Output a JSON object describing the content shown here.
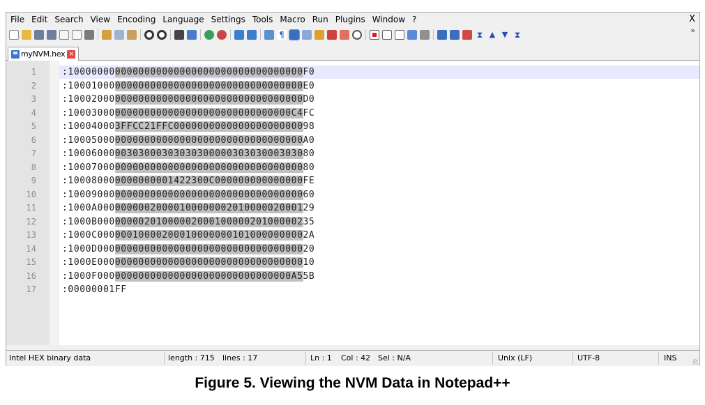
{
  "menu": [
    "File",
    "Edit",
    "Search",
    "View",
    "Encoding",
    "Language",
    "Settings",
    "Tools",
    "Macro",
    "Run",
    "Plugins",
    "Window",
    "?"
  ],
  "window_close": "X",
  "toolbar_overflow": "»",
  "tab": {
    "filename": "myNVM.hex",
    "close": "×"
  },
  "lines": [
    {
      "n": "1",
      "pre": ":10000000",
      "sel": "00000000000000000000000000000000",
      "post": "F0"
    },
    {
      "n": "2",
      "pre": ":10001000",
      "sel": "00000000000000000000000000000000",
      "post": "E0"
    },
    {
      "n": "3",
      "pre": ":10002000",
      "sel": "00000000000000000000000000000000",
      "post": "D0"
    },
    {
      "n": "4",
      "pre": ":10003000",
      "sel": "000000000000000000000000000000C4",
      "post": "FC"
    },
    {
      "n": "5",
      "pre": ":10004000",
      "sel": "3FFCC21FFC0000000000000000000000",
      "post": "98"
    },
    {
      "n": "6",
      "pre": ":10005000",
      "sel": "00000000000000000000000000000000",
      "post": "A0"
    },
    {
      "n": "7",
      "pre": ":10006000",
      "sel": "00303000303030300000303030003030",
      "post": "80"
    },
    {
      "n": "8",
      "pre": ":10007000",
      "sel": "00000000000000000000000000000000",
      "post": "80"
    },
    {
      "n": "9",
      "pre": ":10008000",
      "sel": "0000000001422300C000000000000000",
      "post": "FE"
    },
    {
      "n": "10",
      "pre": ":10009000",
      "sel": "00000000000000000000000000000000",
      "post": "60"
    },
    {
      "n": "11",
      "pre": ":1000A000",
      "sel": "00000020000100000002010000020001",
      "post": "29"
    },
    {
      "n": "12",
      "pre": ":1000B000",
      "sel": "00000201000002000100000201000002",
      "post": "35"
    },
    {
      "n": "13",
      "pre": ":1000C000",
      "sel": "00010000200010000000101000000000",
      "post": "2A"
    },
    {
      "n": "14",
      "pre": ":1000D000",
      "sel": "00000000000000000000000000000000",
      "post": "20"
    },
    {
      "n": "15",
      "pre": ":1000E000",
      "sel": "00000000000000000000000000000000",
      "post": "10"
    },
    {
      "n": "16",
      "pre": ":1000F000",
      "sel": "000000000000000000000000000000A5",
      "post": "5B"
    },
    {
      "n": "17",
      "pre": ":00000001FF",
      "sel": "",
      "post": ""
    }
  ],
  "status": {
    "type": "Intel HEX binary data",
    "length": "length : 715",
    "lines": "lines : 17",
    "ln": "Ln : 1",
    "col": "Col : 42",
    "sel": "Sel : N/A",
    "eol": "Unix (LF)",
    "encoding": "UTF-8",
    "mode": "INS"
  },
  "caption": "Figure 5. Viewing the NVM Data in Notepad++",
  "colors": {
    "selection": "#c0c0c0",
    "caret_line": "#e8e8ff",
    "gutter": "#e4e4e4"
  }
}
